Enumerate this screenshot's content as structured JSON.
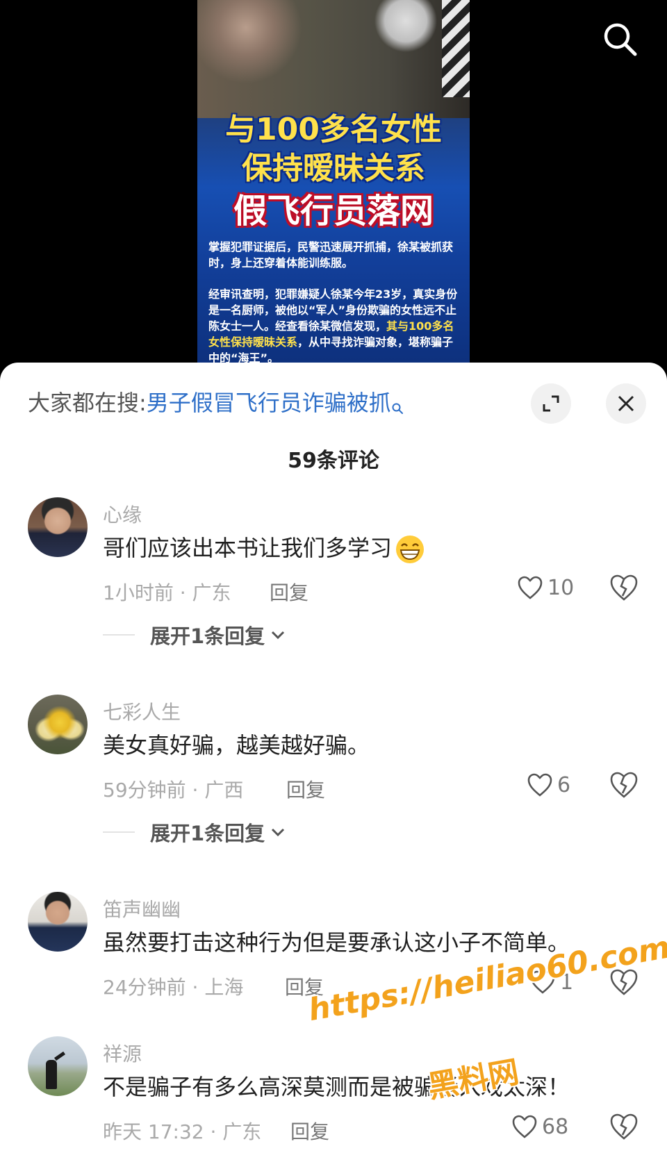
{
  "video": {
    "title_line1": "与100多名女性",
    "title_line2": "保持暧昧关系",
    "title_line3": "假飞行员落网",
    "para1": "掌握犯罪证据后，民警迅速展开抓捕，徐某被抓获时，身上还穿着体能训练服。",
    "para2_a": "经审讯查明，犯罪嫌疑人徐某今年23岁，真实身份是一名厨师，被他以“军人”身份欺骗的女性远不止陈女士一人。经查看徐某微信发现，",
    "para2_hl": "其与100多名女性保持暧昧关系",
    "para2_b": "，从中寻找诈骗对象，堪称骗子中的“海王”。"
  },
  "search_bar": {
    "prefix": "大家都在搜:",
    "query": "男子假冒飞行员诈骗被抓"
  },
  "comments_header": {
    "count_label": "59条评论"
  },
  "comments": [
    {
      "user": "心缘",
      "text": "哥们应该出本书让我们多学习",
      "meta": "1小时前 · 广东",
      "reply": "回复",
      "likes": "10",
      "expand": "展开1条回复"
    },
    {
      "user": "七彩人生",
      "text": "美女真好骗，越美越好骗。",
      "meta": "59分钟前 · 广西",
      "reply": "回复",
      "likes": "6",
      "expand": "展开1条回复"
    },
    {
      "user": "笛声幽幽",
      "text": "虽然要打击这种行为但是要承认这小子不简单。",
      "meta": "24分钟前 · 上海",
      "reply": "回复",
      "likes": "1"
    },
    {
      "user": "祥源",
      "text": "不是骗子有多么高深莫测而是被骗者入戏太深！",
      "meta": "昨天 17:32 · 广东",
      "reply": "回复",
      "likes": "68"
    }
  ],
  "watermark": {
    "url": "https://heiliao60.com",
    "name": "黑料网"
  },
  "colors": {
    "link": "#2e6fc8",
    "watermark": "#f3a21c"
  },
  "icons": [
    "search-icon",
    "expand-icon",
    "close-icon",
    "heart-icon",
    "broken-heart-icon",
    "chevron-down-icon",
    "grin-emoji-icon"
  ]
}
